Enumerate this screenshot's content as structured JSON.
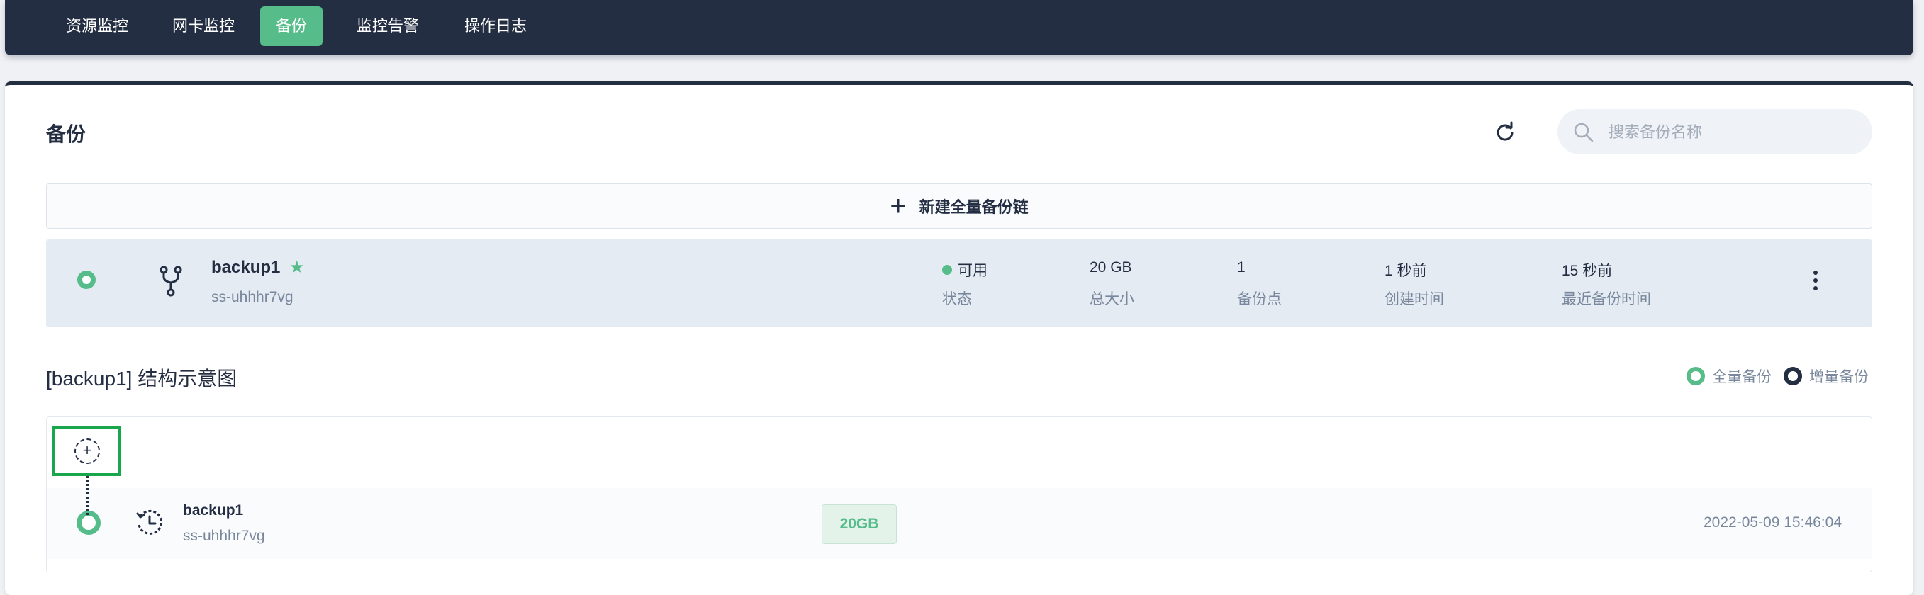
{
  "nav": {
    "tabs": [
      {
        "label": "资源监控"
      },
      {
        "label": "网卡监控"
      },
      {
        "label": "备份",
        "active": true
      },
      {
        "label": "监控告警"
      },
      {
        "label": "操作日志"
      }
    ]
  },
  "page": {
    "title": "备份",
    "search_placeholder": "搜索备份名称",
    "new_chain_label": "新建全量备份链"
  },
  "backup": {
    "name": "backup1",
    "id": "ss-uhhhr7vg",
    "stats": [
      {
        "value": "可用",
        "label": "状态"
      },
      {
        "value": "20 GB",
        "label": "总大小"
      },
      {
        "value": "1",
        "label": "备份点"
      },
      {
        "value": "1 秒前",
        "label": "创建时间"
      },
      {
        "value": "15 秒前",
        "label": "最近备份时间"
      }
    ]
  },
  "diagram": {
    "title": "[backup1] 结构示意图",
    "legend": {
      "full": "全量备份",
      "incremental": "增量备份"
    },
    "node": {
      "name": "backup1",
      "id": "ss-uhhhr7vg",
      "size": "20GB",
      "time": "2022-05-09 15:46:04"
    }
  },
  "colors": {
    "nav_bg": "#242e42",
    "accent": "#55bc8a",
    "item_bg": "#e4ebf3",
    "muted": "#79879c"
  }
}
